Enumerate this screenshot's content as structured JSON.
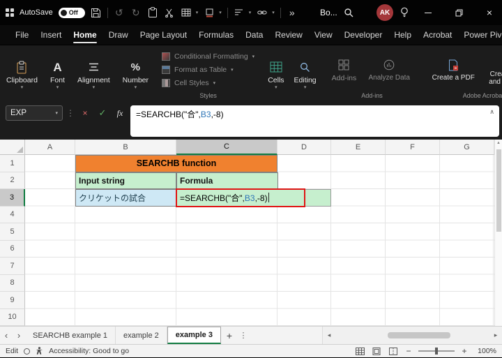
{
  "titlebar": {
    "autosave_label": "AutoSave",
    "autosave_state": "Off",
    "doc_title": "Bo...",
    "avatar_initials": "AK"
  },
  "menubar": {
    "tabs": [
      "File",
      "Insert",
      "Home",
      "Draw",
      "Page Layout",
      "Formulas",
      "Data",
      "Review",
      "View",
      "Developer",
      "Help",
      "Acrobat",
      "Power Pivot"
    ],
    "active_tab": "Home"
  },
  "ribbon": {
    "buttons": {
      "clipboard": "Clipboard",
      "font": "Font",
      "alignment": "Alignment",
      "number": "Number",
      "cells": "Cells",
      "editing": "Editing",
      "addins": "Add-ins",
      "analyze_data": "Analyze Data",
      "create_pdf": "Create a PDF",
      "create_pdf_share": "Create a PDF and Share link"
    },
    "styles_menu": [
      "Conditional Formatting",
      "Format as Table",
      "Cell Styles"
    ],
    "group_labels": {
      "styles": "Styles",
      "addins": "Add-ins",
      "acrobat": "Adobe Acrobat"
    }
  },
  "formula_bar": {
    "name_box": "EXP",
    "fx_label": "fx",
    "formula_prefix": "=SEARCHB(\"合\",",
    "formula_ref": "B3",
    "formula_suffix": ",-8)"
  },
  "grid": {
    "column_headers": [
      "A",
      "B",
      "C",
      "D",
      "E",
      "F",
      "G"
    ],
    "row_headers": [
      "1",
      "2",
      "3",
      "4",
      "5",
      "6",
      "7",
      "8",
      "9",
      "10"
    ],
    "selected_column": "C",
    "selected_row": "3",
    "cells": {
      "title": "SEARCHB function",
      "input_header": "Input string",
      "formula_header": "Formula",
      "input_value": "クリケットの試合",
      "formula_prefix": "=SEARCHB(\"合\",",
      "formula_ref": "B3",
      "formula_suffix": ",-8)"
    }
  },
  "sheet_tabs": {
    "tabs": [
      "SEARCHB example 1",
      "example 2",
      "example 3"
    ],
    "active_tab": "example 3"
  },
  "status_bar": {
    "mode": "Edit",
    "accessibility": "Accessibility: Good to go",
    "zoom": "100%"
  },
  "colors": {
    "title_orange": "#F0812F",
    "header_green": "#C6EFCE",
    "input_blue": "#CEE8F5",
    "edit_border_red": "#E01414",
    "reference_blue": "#2E75B6",
    "excel_green": "#107C41"
  },
  "icons": {
    "chevron_down": "▾",
    "chevron_up": "∧",
    "more": "»",
    "undo": "↺",
    "redo": "↻",
    "dots_vertical": "⋮",
    "cancel": "×",
    "confirm": "✓",
    "nav_left": "‹",
    "nav_right": "›",
    "scroll_left": "◂",
    "scroll_right": "▸",
    "scroll_up": "▲",
    "add_sheet": "+",
    "zoom_out": "−",
    "zoom_in": "+",
    "close": "×"
  }
}
